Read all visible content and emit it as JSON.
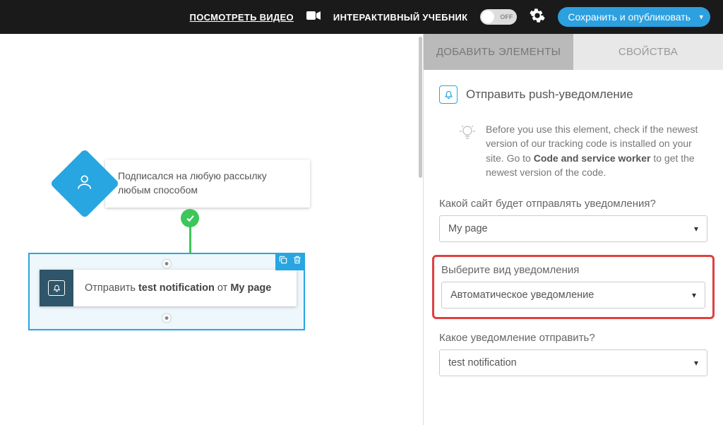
{
  "header": {
    "watch_video": "ПОСМОТРЕТЬ ВИДЕО",
    "interactive_tutorial": "ИНТЕРАКТИВНЫЙ УЧЕБНИК",
    "toggle_state": "OFF",
    "publish": "Сохранить и опубликовать"
  },
  "canvas": {
    "trigger_line1": "Подписался на любую рассылку",
    "trigger_line2": "любым способом",
    "action_prefix": "Отправить ",
    "action_bold1": "test notification",
    "action_mid": " от ",
    "action_bold2": "My page"
  },
  "sidebar": {
    "tabs": {
      "add": "ДОБАВИТЬ ЭЛЕМЕНТЫ",
      "props": "СВОЙСТВА"
    },
    "section_title": "Отправить push-уведомление",
    "hint_p1": "Before you use this element, check if the newest version of our tracking code is installed on your site. Go to ",
    "hint_b1": "Code and service worker",
    "hint_p2": " to get the newest version of the code.",
    "fields": {
      "site_label": "Какой сайт будет отправлять уведомления?",
      "site_value": "My page",
      "type_label": "Выберите вид уведомления",
      "type_value": "Автоматическое уведомление",
      "which_label": "Какое уведомление отправить?",
      "which_value": "test notification"
    }
  }
}
